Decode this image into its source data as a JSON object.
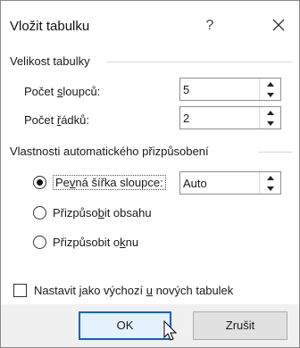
{
  "window": {
    "title": "Vložit tabulku",
    "help_label": "?"
  },
  "table_size": {
    "section_label": "Velikost tabulky",
    "columns": {
      "label_pre": "Počet ",
      "label_access": "s",
      "label_post": "loupců:",
      "value": "5"
    },
    "rows": {
      "label_pre": "Počet ",
      "label_access": "ř",
      "label_post": "ádků:",
      "value": "2"
    }
  },
  "autofit": {
    "section_label": "Vlastnosti automatického přizpůsobení",
    "fixed_width": {
      "label_pre": "Pe",
      "label_access": "v",
      "label_post": "ná šířka sloupce:",
      "checked": true,
      "value": "Auto"
    },
    "fit_contents": {
      "label_pre": "Přizpůso",
      "label_access": "b",
      "label_post": "it obsahu",
      "checked": false
    },
    "fit_window": {
      "label_pre": "Přizpůsobit o",
      "label_access": "k",
      "label_post": "nu",
      "checked": false
    }
  },
  "remember": {
    "label_pre": "Nastavit jako výchozí ",
    "label_access": "u",
    "label_post": " nových tabulek",
    "checked": false
  },
  "buttons": {
    "ok_label": "OK",
    "cancel_label": "Zrušit"
  },
  "colors": {
    "accent": "#0a64c8",
    "selection": "#3c7fd6",
    "bottom_bar": "#f0f0f0"
  }
}
